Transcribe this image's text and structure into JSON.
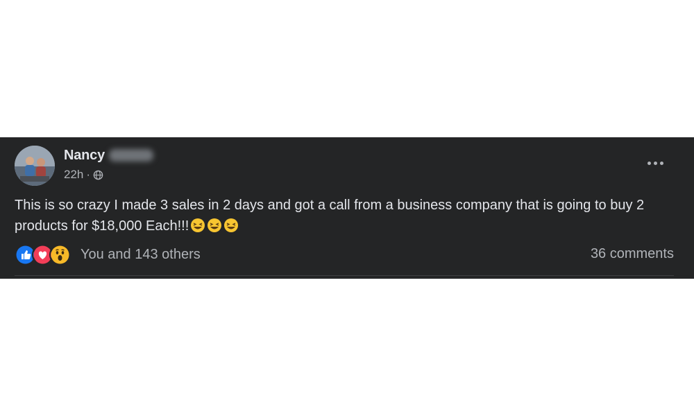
{
  "post": {
    "author_name": "Nancy",
    "timestamp": "22h",
    "separator": "·",
    "audience_icon": "globe-icon",
    "body_text": "This is so crazy I made 3 sales in 2 days and got a call from a business company that is going to buy 2 products for $18,000 Each!!!",
    "emojis": [
      "laughing-face-icon",
      "laughing-face-icon",
      "laughing-face-icon"
    ],
    "reaction_icons": [
      "like-icon",
      "love-icon",
      "wow-icon"
    ],
    "reaction_summary": "You and 143 others",
    "comments_label": "36 comments"
  },
  "colors": {
    "card_background": "#242526",
    "primary_text": "#e4e6eb",
    "secondary_text": "#b0b3b8",
    "like_blue": "#1877f2",
    "love_red": "#f33e58",
    "wow_yellow": "#f7b928"
  }
}
